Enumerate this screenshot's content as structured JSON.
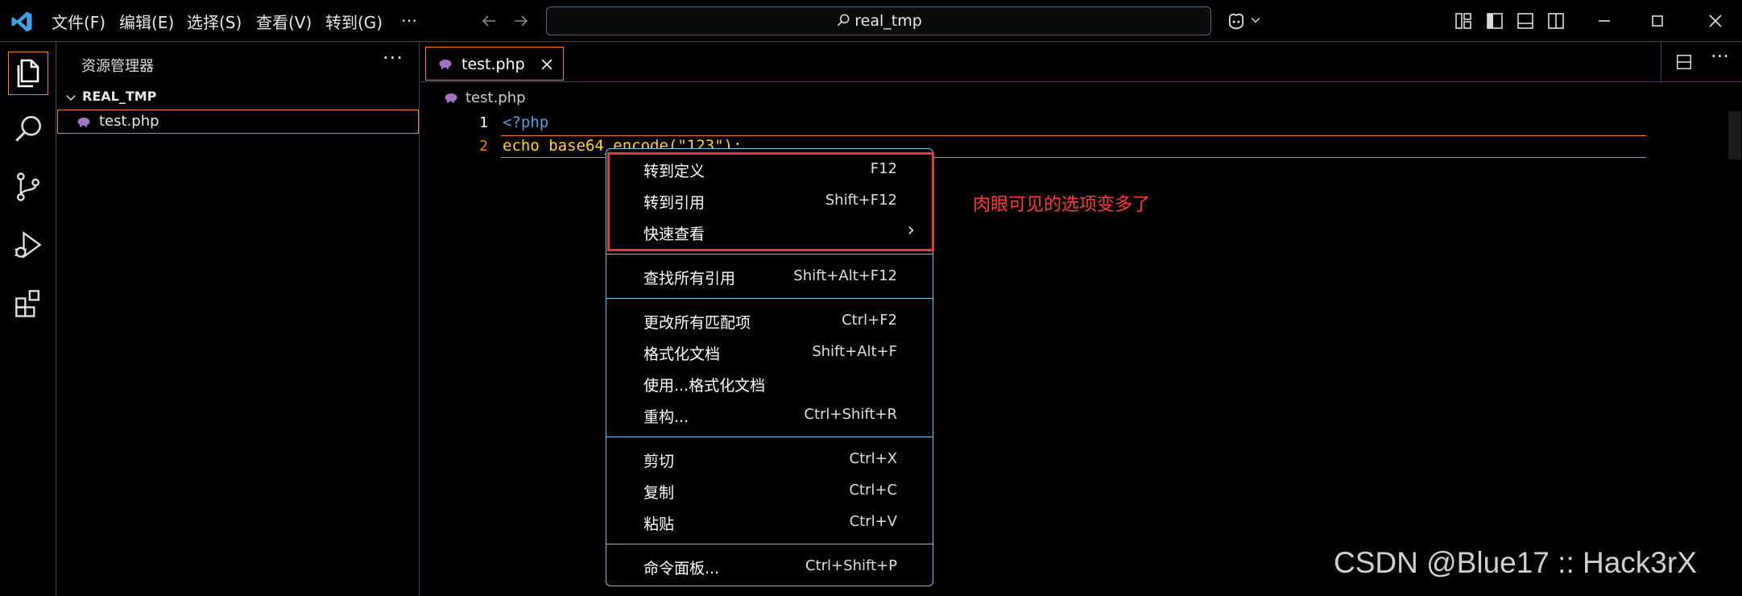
{
  "titlebar": {
    "menus": [
      "文件(F)",
      "编辑(E)",
      "选择(S)",
      "查看(V)",
      "转到(G)"
    ],
    "more": "…",
    "search_text": "real_tmp"
  },
  "sidebar": {
    "title": "资源管理器",
    "more": "···",
    "folder": "REAL_TMP",
    "file": "test.php"
  },
  "editor": {
    "tab_label": "test.php",
    "breadcrumb": "test.php",
    "lines": [
      {
        "num": "1",
        "text": "<?php"
      },
      {
        "num": "2",
        "text": "echo base64_encode(\"123\");"
      }
    ]
  },
  "context_menu": {
    "items": [
      {
        "label": "转到定义",
        "key": "F12"
      },
      {
        "label": "转到引用",
        "key": "Shift+F12"
      },
      {
        "label": "快速查看",
        "key": "›"
      },
      {
        "label": "查找所有引用",
        "key": "Shift+Alt+F12"
      },
      {
        "label": "更改所有匹配项",
        "key": "Ctrl+F2"
      },
      {
        "label": "格式化文档",
        "key": "Shift+Alt+F"
      },
      {
        "label": "使用...格式化文档",
        "key": ""
      },
      {
        "label": "重构...",
        "key": "Ctrl+Shift+R"
      },
      {
        "label": "剪切",
        "key": "Ctrl+X"
      },
      {
        "label": "复制",
        "key": "Ctrl+C"
      },
      {
        "label": "粘贴",
        "key": "Ctrl+V"
      },
      {
        "label": "命令面板...",
        "key": "Ctrl+Shift+P"
      }
    ]
  },
  "annotation": "肉眼可见的选项变多了",
  "watermark": "CSDN @Blue17 :: Hack3rX",
  "colors": {
    "accent_border": "#6fc3df",
    "focus_orange": "#f38518",
    "annotation_red": "#e0393e",
    "php_icon": "#a074c4"
  }
}
